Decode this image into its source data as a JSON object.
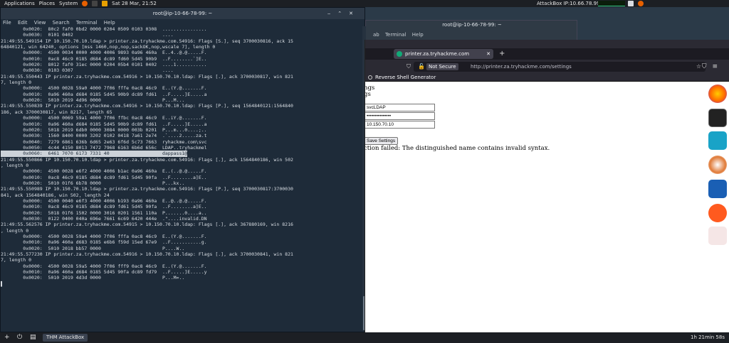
{
  "topbar": {
    "applications": "Applications",
    "places": "Places",
    "system": "System",
    "datetime": "Sat 28 Mar, 21:52",
    "ip_label": "AttackBox IP:10.66.78.99"
  },
  "bg_terminal": {
    "title": "root@ip-10-66-78-99: ~",
    "menu": "ab   Terminal   Help"
  },
  "terminal": {
    "title": "root@ip-10-66-78-99: ~",
    "menu": [
      "File",
      "Edit",
      "View",
      "Search",
      "Terminal",
      "Help"
    ],
    "lines_before": [
      "        0x0020:  80c2 faf0 0bd2 0000 0204 0509 0103 0308  ................",
      "        0x0030:  0101 0402                                ....",
      "21:49:55.549154 IP 10.150.70.10.ldap > printer.za.tryhackme.com.54916: Flags [S.], seq 3700030816, ack 15",
      "64840121, win 64240, options [mss 1460,nop,nop,sackOK,nop,wscale 7], length 0",
      "        0x0000:  4500 0034 0000 4000 4006 9893 0a96 460a  E..4..@.@.....F.",
      "        0x0010:  0ac8 46c9 0185 d684 dc89 fd60 5d45 90b9  ..F........`]E..",
      "        0x0020:  8012 faf0 31ec 0000 0204 05b4 0101 0402  ....1...........",
      "        0x0030:  0103 0307                                ....",
      "21:49:55.550443 IP printer.za.tryhackme.com.54916 > 10.150.70.10.ldap: Flags [.], ack 3700030817, win 821",
      "7, length 0",
      "        0x0000:  4500 0028 59a0 4000 7f06 fffe 0ac8 46c9  E..(Y.@.......F.",
      "        0x0010:  0a96 460a d684 0185 5d45 90b9 dc89 fd61  ..F.....]E.....a",
      "        0x0020:  5010 2019 4d96 0000                      P...M...",
      "21:49:55.550839 IP printer.za.tryhackme.com.54916 > 10.150.70.10.ldap: Flags [P.], seq 1564840121:1564840",
      "186, ack 3700030817, win 8217, length 65",
      "        0x0000:  4500 0069 59a1 4000 7f06 ffbc 0ac8 46c9  E..iY.@.......F.",
      "        0x0010:  0a96 460a d684 0185 5d45 90b9 dc89 fd61  ..F.....]E.....a",
      "        0x0020:  5018 2019 6db0 0000 3084 0000 003b 0201  P...m...0....;..",
      "        0x0030:  1560 8400 0000 3202 0102 0418 7a61 2e74  .`....2.....za.t",
      "        0x0040:  7279 6861 636b 6d65 2e63 6f6d 5c73 7663  ryhackme.com\\svc",
      "        0x0050:  4c44 4150 8013 7472 7968 6163 6b6d 656c  LDAP..tryhackmel"
    ],
    "highlight_line": "        0x0060:  6461 7070 6173 7331 40                   dappass1@",
    "lines_after": [
      "21:49:55.550866 IP 10.150.70.10.ldap > printer.za.tryhackme.com.54916: Flags [.], ack 1564840186, win 502",
      ", length 0",
      "        0x0000:  4500 0028 e6f2 4000 4006 b1ac 0a96 460a  E..(..@.@.....F.",
      "        0x0010:  0ac8 46c9 0185 d684 dc89 fd61 5d45 90fa  ..F........a]E..",
      "        0x0020:  5010 01f6 6b78 0000                      P...kx..",
      "21:49:55.550989 IP 10.150.70.10.ldap > printer.za.tryhackme.com.54916: Flags [P.], seq 3700030817:3700030",
      "841, ack 1564840186, win 502, length 24",
      "        0x0000:  4500 0040 e6f3 4000 4006 b193 0a96 460a  E..@..@.@.....F.",
      "        0x0010:  0ac8 46c9 0185 d684 dc89 fd61 5d45 90fa  ..F........a]E..",
      "        0x0020:  5018 01f6 1502 0000 3016 0201 1561 110a  P.......0....a..",
      "        0x0030:  0122 0400 040a 696e 7661 6c69 6420 444e  .\"....invalid.DN",
      "21:49:55.562576 IP printer.za.tryhackme.com.54915 > 10.150.70.10.ldap: Flags [.], ack 367880169, win 8216",
      ", length 0",
      "        0x0000:  4500 0028 59a4 4000 7f06 fffa 0ac8 46c9  E..(Y.@.......F.",
      "        0x0010:  0a96 460a d683 0185 e6b6 f59d 15ed 67e9  ..F...........g.",
      "        0x0020:  5010 2018 bb57 0000                      P....W..",
      "21:49:55.577230 IP printer.za.tryhackme.com.54916 > 10.150.70.10.ldap: Flags [.], ack 3700030841, win 821",
      "7, length 0",
      "        0x0000:  4500 0028 59a5 4000 7f06 fff9 0ac8 46c9  E..(Y.@.......F.",
      "        0x0010:  0a96 460a d684 0185 5d45 90fa dc89 fd79  ..F.....]E.....y",
      "        0x0020:  5010 2019 4d3d 0000                      P...M=..",
      "",
      "▌"
    ]
  },
  "browser": {
    "tab_title": "printer.za.tryhackme.com",
    "url_badge": "Not Secure",
    "url": "http://printer.za.tryhackme.com/settings",
    "bookmark": "Reverse Shell Generator",
    "page": {
      "heading1": "ngs",
      "heading2": "gs",
      "username_value": "svcLDAP",
      "password_value": "•••••••••••••••",
      "server_value": "10.150.70.10",
      "save_button": "Save Settings",
      "error": "ction failed: The distinguished name contains invalid syntax."
    }
  },
  "taskbar": {
    "app_label": "THM AttackBox",
    "timer": "1h 21min 58s"
  },
  "colors": {
    "terminal_bg": "#1e2b39",
    "browser_chrome": "#2b2a33",
    "highlight": "#ccd2d8"
  }
}
